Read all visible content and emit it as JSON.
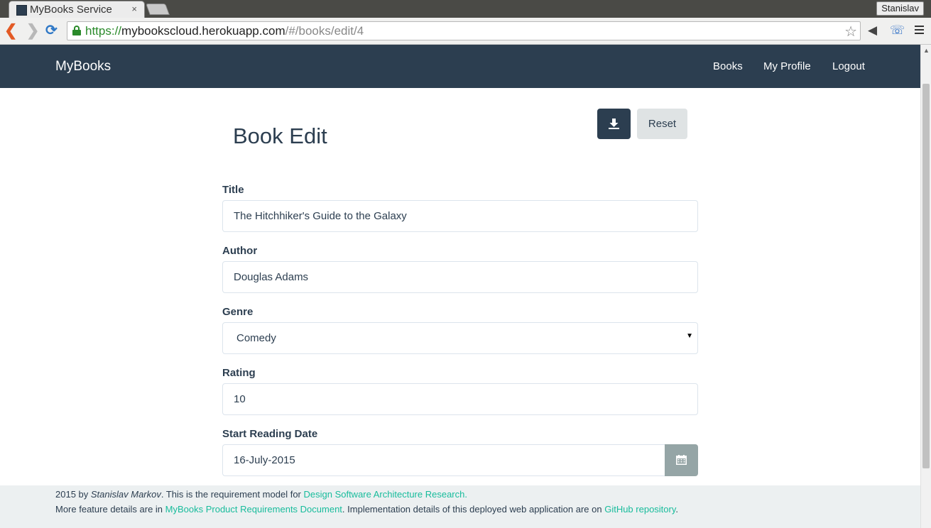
{
  "browser": {
    "tab_title": "MyBooks Service",
    "tab_close": "×",
    "profile_name": "Stanislav",
    "url_scheme": "https://",
    "url_host": "mybookscloud.herokuapp.com",
    "url_path": "/#/books/edit/4",
    "icons": [
      "back-icon",
      "forward-icon",
      "reload-icon",
      "lock-icon",
      "star-icon",
      "extension-icon",
      "menu-icon"
    ]
  },
  "navbar": {
    "brand": "MyBooks",
    "links": [
      "Books",
      "My Profile",
      "Logout"
    ]
  },
  "page": {
    "title": "Book Edit",
    "save_icon": "download-icon",
    "reset_label": "Reset"
  },
  "form": {
    "title_label": "Title",
    "title_value": "The Hitchhiker's Guide to the Galaxy",
    "author_label": "Author",
    "author_value": "Douglas Adams",
    "genre_label": "Genre",
    "genre_value": "Comedy",
    "rating_label": "Rating",
    "rating_value": "10",
    "start_date_label": "Start Reading Date",
    "start_date_value": "16-July-2015",
    "calendar_icon": "calendar-icon"
  },
  "footer": {
    "line1_year": "2015 by ",
    "line1_author": "Stanislav Markov",
    "line1_text": ". This is the requirement model for ",
    "line1_link": "Design Software Architecture Research.",
    "line2_text_a": "More feature details are in ",
    "line2_link_a": "MyBooks Product Requirements Document",
    "line2_text_b": ". Implementation details of this deployed web application are on ",
    "line2_link_b": "GitHub repository",
    "line2_text_c": "."
  },
  "colors": {
    "navbar": "#2c3e50",
    "link": "#18bc9c",
    "footer_bg": "#ecf0f1",
    "reset_bg": "#dfe3e4",
    "calendar_btn": "#95a5a6"
  }
}
